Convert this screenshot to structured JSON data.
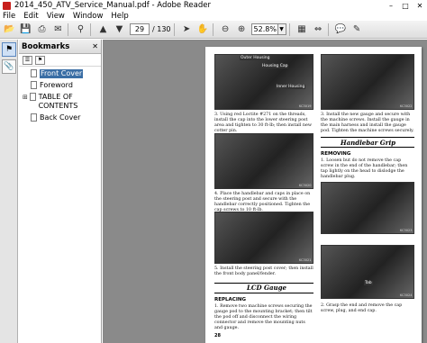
{
  "window": {
    "title": "2014_450_ATV_Service_Manual.pdf - Adobe Reader",
    "minimize": "–",
    "maximize": "□",
    "close": "✕"
  },
  "menu": [
    "File",
    "Edit",
    "View",
    "Window",
    "Help"
  ],
  "toolbar": {
    "page_current": "29",
    "page_total": "/ 130",
    "zoom": "52.8%",
    "icons": [
      "open-icon",
      "save-icon",
      "print-icon",
      "email-icon",
      "search-icon",
      "prev-page-icon",
      "next-page-icon",
      "select-arrow-icon",
      "hand-icon",
      "zoom-out-icon",
      "zoom-in-icon",
      "fit-page-icon",
      "fit-width-icon",
      "comment-icon",
      "sign-icon"
    ]
  },
  "bookmarks": {
    "header": "Bookmarks",
    "items": [
      {
        "label": "Front Cover",
        "expandable": false
      },
      {
        "label": "Foreword",
        "expandable": false
      },
      {
        "label": "TABLE OF CONTENTS",
        "expandable": true
      },
      {
        "label": "Back Cover",
        "expandable": false
      }
    ]
  },
  "page": {
    "photo_labels": [
      "Outer Housing",
      "Housing Cap",
      "Inner Housing",
      "Tab"
    ],
    "captions": {
      "c3": "3. Using red Loctite #271 on the threads, install the cap into the lower steering post area and tighten to 30 ft-lb; then install new cotter pin.",
      "c4": "4. Place the handlebar and caps in place on the steering post and secure with the handlebar correctly positioned. Tighten the cap screws to 10 ft-lb.",
      "c5": "5. Install the steering post cover; then install the front body panel/fender.",
      "r3": "3. Install the new gauge and secure with the machine screws. Install the gauge in the main harness and install the gauge pod. Tighten the machine screws securely.",
      "removing1": "1. Loosen but do not remove the cap screw in the end of the handlebar; then tap lightly on the head to dislodge the handlebar plug.",
      "removing2": "2. Grasp the end and remove the cap screw, plug, and end cap.",
      "replacing1": "1. Remove two machine screws securing the gauge pod to the mounting bracket; then tilt the pod off and disconnect the wiring connector and remove the mounting nuts and gauge."
    },
    "section_handlebar": "Handlebar Grip",
    "section_lcd": "LCD Gauge",
    "sub_removing": "REMOVING",
    "sub_replacing": "REPLACING",
    "page_number": "28",
    "fig_numbers": [
      "KC3019",
      "KC3020",
      "KC3021",
      "KC3022",
      "KC3023",
      "KC3024"
    ]
  }
}
